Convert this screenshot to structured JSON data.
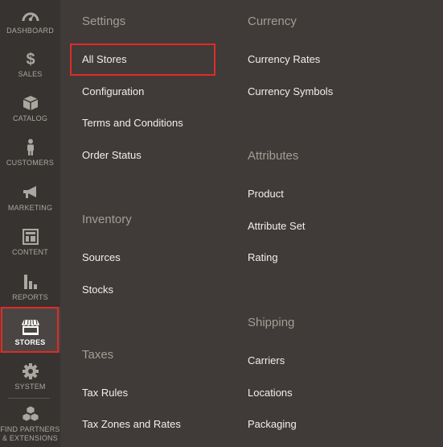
{
  "sidebar": {
    "items": [
      {
        "label": "DASHBOARD",
        "icon": "dashboard-icon"
      },
      {
        "label": "SALES",
        "icon": "dollar-icon"
      },
      {
        "label": "CATALOG",
        "icon": "box-icon"
      },
      {
        "label": "CUSTOMERS",
        "icon": "person-icon"
      },
      {
        "label": "MARKETING",
        "icon": "megaphone-icon"
      },
      {
        "label": "CONTENT",
        "icon": "layout-icon"
      },
      {
        "label": "REPORTS",
        "icon": "bar-chart-icon"
      },
      {
        "label": "STORES",
        "icon": "storefront-icon",
        "active": true
      },
      {
        "label": "SYSTEM",
        "icon": "gear-icon"
      },
      {
        "label": "FIND PARTNERS",
        "label2": "& EXTENSIONS",
        "icon": "cubes-icon"
      }
    ]
  },
  "flyout": {
    "settings": {
      "title": "Settings",
      "links": [
        "All Stores",
        "Configuration",
        "Terms and Conditions",
        "Order Status"
      ]
    },
    "inventory": {
      "title": "Inventory",
      "links": [
        "Sources",
        "Stocks"
      ]
    },
    "taxes": {
      "title": "Taxes",
      "links": [
        "Tax Rules",
        "Tax Zones and Rates"
      ]
    },
    "currency": {
      "title": "Currency",
      "links": [
        "Currency Rates",
        "Currency Symbols"
      ]
    },
    "attributes": {
      "title": "Attributes",
      "links": [
        "Product",
        "Attribute Set",
        "Rating"
      ]
    },
    "shipping": {
      "title": "Shipping",
      "links": [
        "Carriers",
        "Locations",
        "Packaging"
      ]
    }
  },
  "colors": {
    "highlight": "#e02b27",
    "sidebar_bg": "#373330",
    "panel_bg": "#403b38",
    "section_title": "#a39d97",
    "link": "#f1eeeb"
  }
}
